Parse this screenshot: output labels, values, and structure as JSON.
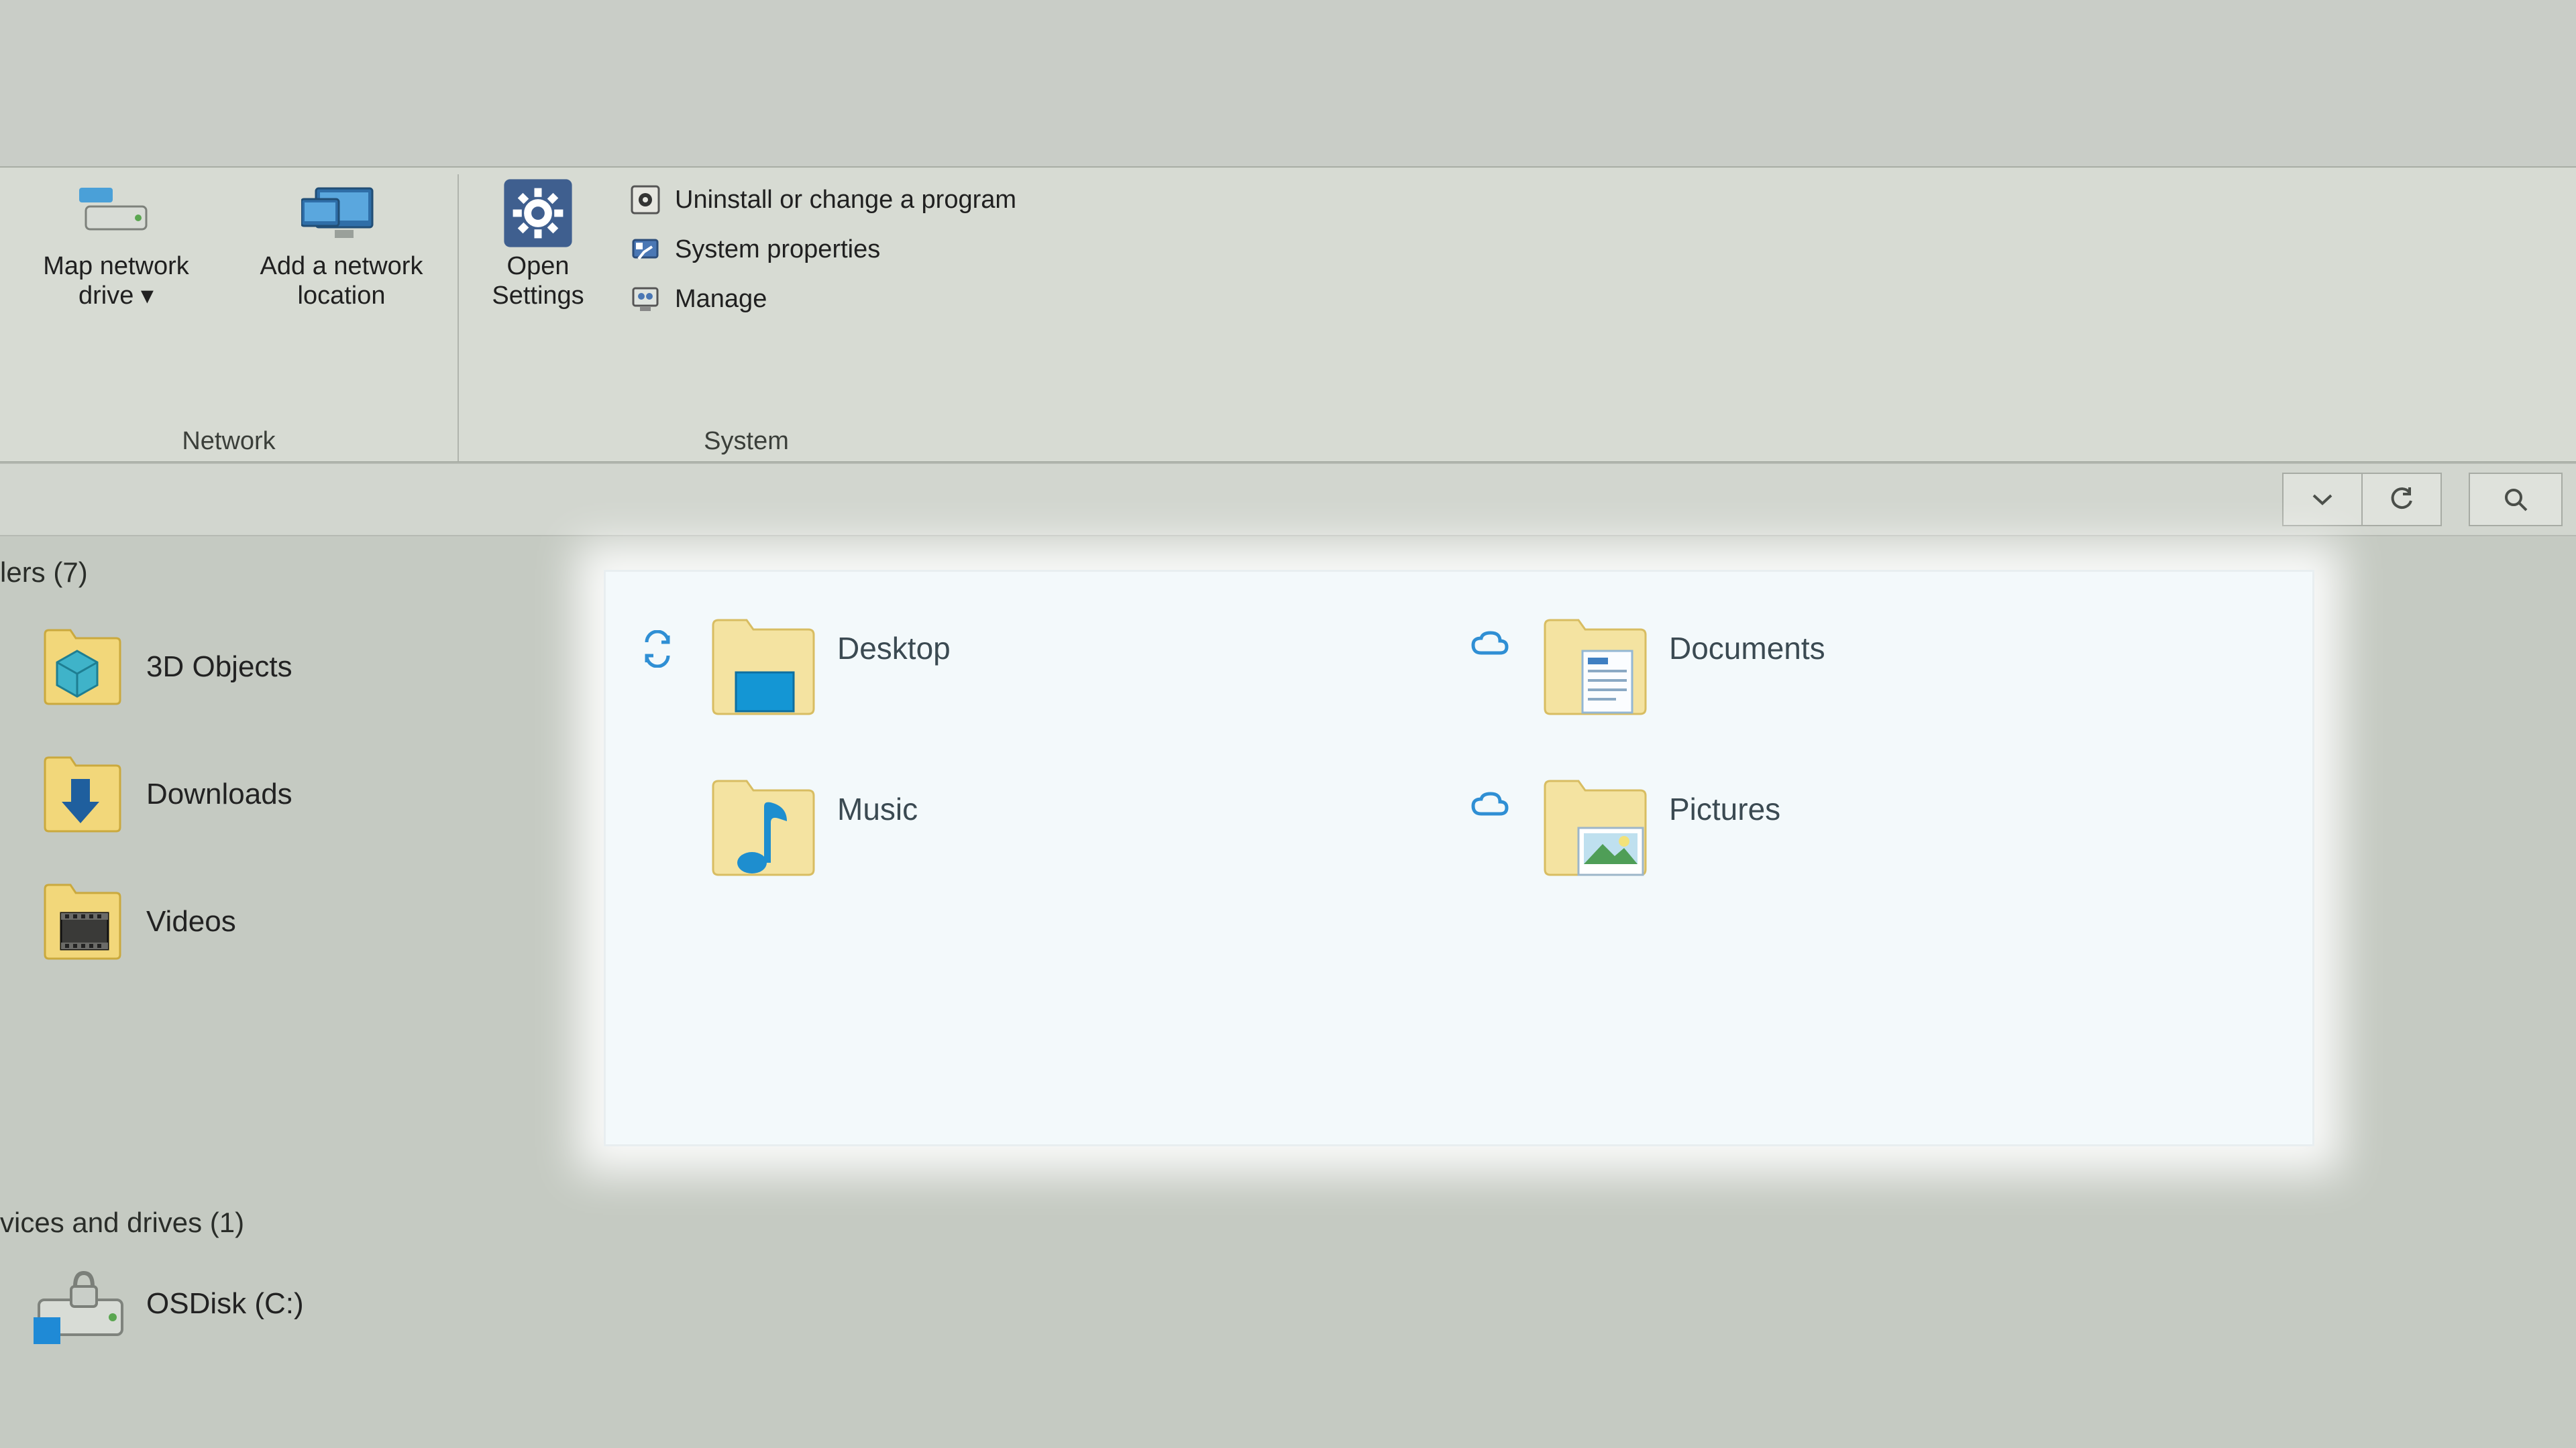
{
  "ribbon": {
    "groups": {
      "network": {
        "label": "Network",
        "map_drive": "Map network drive ▾",
        "add_location": "Add a network location"
      },
      "system": {
        "label": "System",
        "open_settings": "Open Settings",
        "uninstall": "Uninstall or change a program",
        "properties": "System properties",
        "manage": "Manage"
      }
    }
  },
  "folders_header": "lers (7)",
  "folders_left": [
    {
      "name": "3D Objects",
      "icon": "cube"
    },
    {
      "name": "Downloads",
      "icon": "download"
    },
    {
      "name": "Videos",
      "icon": "film"
    }
  ],
  "spotlight": [
    {
      "name": "Desktop",
      "icon": "desktop",
      "status": "sync"
    },
    {
      "name": "Documents",
      "icon": "document",
      "status": "cloud"
    },
    {
      "name": "Music",
      "icon": "music",
      "status": ""
    },
    {
      "name": "Pictures",
      "icon": "picture",
      "status": "cloud"
    }
  ],
  "devices_header": "vices and drives (1)",
  "drive_label": "OSDisk (C:)"
}
